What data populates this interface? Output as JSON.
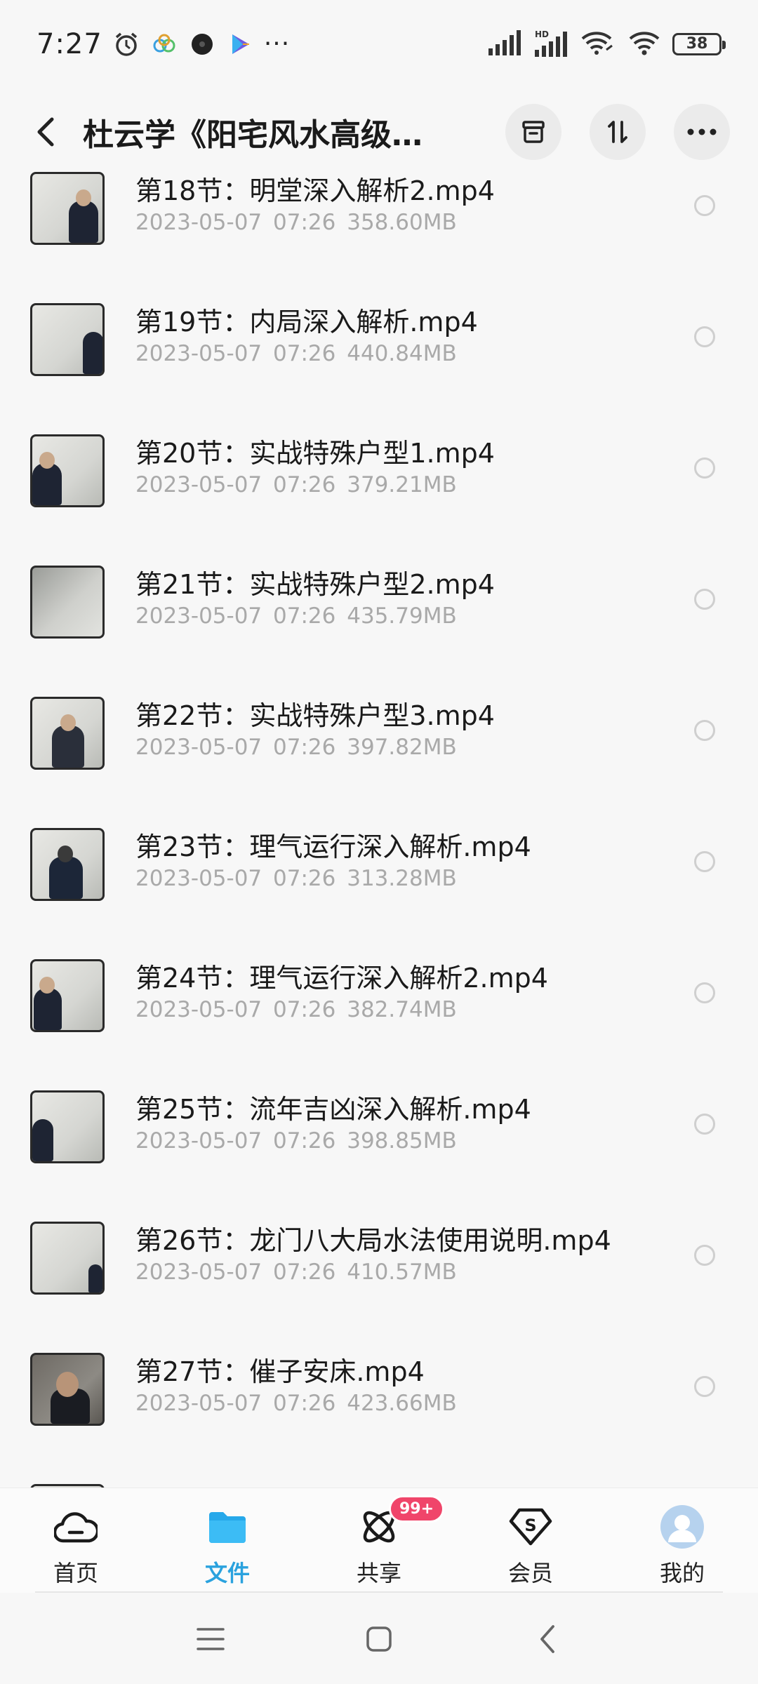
{
  "status_bar": {
    "time": "7:27",
    "more": "···",
    "battery": "38",
    "icons": [
      "alarm-icon",
      "app-icon-1",
      "app-icon-2",
      "play-store-icon",
      "signal-icon",
      "hd-signal-icon",
      "wifi-link-icon",
      "wifi-icon",
      "battery-icon"
    ]
  },
  "header": {
    "title": "杜云学《阳宅风水高级…",
    "back_icon": "back-arrow-icon",
    "actions": [
      "archive-icon",
      "sort-icon",
      "more-icon"
    ]
  },
  "files": [
    {
      "name": "第18节：明堂深入解析2.mp4",
      "date": "2023-05-07",
      "time": "07:26",
      "size": "358.60MB"
    },
    {
      "name": "第19节：内局深入解析.mp4",
      "date": "2023-05-07",
      "time": "07:26",
      "size": "440.84MB"
    },
    {
      "name": "第20节：实战特殊户型1.mp4",
      "date": "2023-05-07",
      "time": "07:26",
      "size": "379.21MB"
    },
    {
      "name": "第21节：实战特殊户型2.mp4",
      "date": "2023-05-07",
      "time": "07:26",
      "size": "435.79MB"
    },
    {
      "name": "第22节：实战特殊户型3.mp4",
      "date": "2023-05-07",
      "time": "07:26",
      "size": "397.82MB"
    },
    {
      "name": "第23节：理气运行深入解析.mp4",
      "date": "2023-05-07",
      "time": "07:26",
      "size": "313.28MB"
    },
    {
      "name": "第24节：理气运行深入解析2.mp4",
      "date": "2023-05-07",
      "time": "07:26",
      "size": "382.74MB"
    },
    {
      "name": "第25节：流年吉凶深入解析.mp4",
      "date": "2023-05-07",
      "time": "07:26",
      "size": "398.85MB"
    },
    {
      "name": "第26节：龙门八大局水法使用说明.mp4",
      "date": "2023-05-07",
      "time": "07:26",
      "size": "410.57MB"
    },
    {
      "name": "第27节：催子安床.mp4",
      "date": "2023-05-07",
      "time": "07:26",
      "size": "423.66MB"
    }
  ],
  "bottom_nav": {
    "items": [
      {
        "label": "首页",
        "icon": "cloud-home-icon",
        "active": false
      },
      {
        "label": "文件",
        "icon": "folder-icon",
        "active": true
      },
      {
        "label": "共享",
        "icon": "share-atom-icon",
        "active": false,
        "badge": "99+"
      },
      {
        "label": "会员",
        "icon": "vip-s-icon",
        "active": false
      },
      {
        "label": "我的",
        "icon": "avatar-icon",
        "active": false
      }
    ]
  },
  "colors": {
    "accent": "#2aa2de",
    "badge": "#f0456a",
    "meta_text": "#a9a9a9"
  }
}
